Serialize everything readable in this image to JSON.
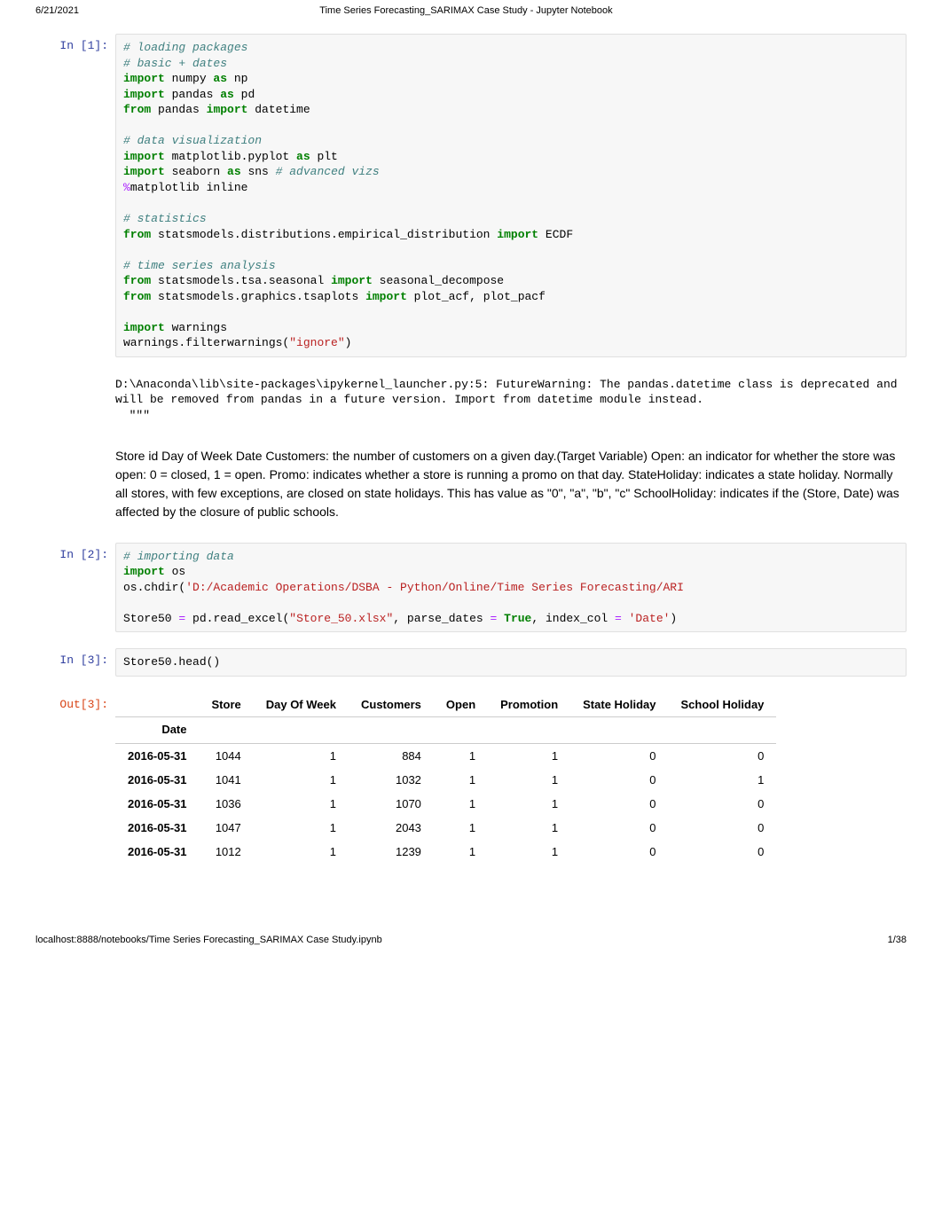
{
  "header": {
    "date": "6/21/2021",
    "title": "Time Series Forecasting_SARIMAX Case Study - Jupyter Notebook"
  },
  "cells": {
    "in1_prompt": "In [1]:",
    "in1": {
      "c1": "# loading packages",
      "c2": "# basic + dates",
      "l3_k1": "import",
      "l3_t1": " numpy ",
      "l3_k2": "as",
      "l3_t2": " np",
      "l4_k1": "import",
      "l4_t1": " pandas ",
      "l4_k2": "as",
      "l4_t2": " pd",
      "l5_k1": "from",
      "l5_t1": " pandas ",
      "l5_k2": "import",
      "l5_t2": " datetime",
      "c6": "# data visualization",
      "l7_k1": "import",
      "l7_t1": " matplotlib.pyplot ",
      "l7_k2": "as",
      "l7_t2": " plt",
      "l8_k1": "import",
      "l8_t1": " seaborn ",
      "l8_k2": "as",
      "l8_t2": " sns ",
      "l8_c": "# advanced vizs",
      "l9_m": "%",
      "l9_t": "matplotlib inline",
      "c10": "# statistics",
      "l11_k1": "from",
      "l11_t1": " statsmodels.distributions.empirical_distribution ",
      "l11_k2": "import",
      "l11_t2": " ECDF",
      "c12": "# time series analysis",
      "l13_k1": "from",
      "l13_t1": " statsmodels.tsa.seasonal ",
      "l13_k2": "import",
      "l13_t2": " seasonal_decompose",
      "l14_k1": "from",
      "l14_t1": " statsmodels.graphics.tsaplots ",
      "l14_k2": "import",
      "l14_t2": " plot_acf, plot_pacf",
      "l15_k1": "import",
      "l15_t1": " warnings",
      "l16_t1": "warnings.filterwarnings(",
      "l16_s": "\"ignore\"",
      "l16_t2": ")"
    },
    "in1_stream": "D:\\Anaconda\\lib\\site-packages\\ipykernel_launcher.py:5: FutureWarning: The pandas.datetime class is deprecated and will be removed from pandas in a future version. Import from datetime module instead.\n  \"\"\"",
    "markdown1": "Store id Day of Week Date Customers: the number of customers on a given day.(Target Variable) Open: an indicator for whether the store was open: 0 = closed, 1 = open. Promo: indicates whether a store is running a promo on that day. StateHoliday: indicates a state holiday. Normally all stores, with few exceptions, are closed on state holidays. This has value as \"0\", \"a\", \"b\", \"c\" SchoolHoliday: indicates if the (Store, Date) was affected by the closure of public schools.",
    "in2_prompt": "In [2]:",
    "in2": {
      "c1": "# importing data",
      "l2_k1": "import",
      "l2_t1": " os",
      "l3_t1": "os.chdir(",
      "l3_s": "'D:/Academic Operations/DSBA - Python/Online/Time Series Forecasting/ARI",
      "l4_t1": "Store50 ",
      "l4_op": "=",
      "l4_t2": " pd.read_excel(",
      "l4_s1": "\"Store_50.xlsx\"",
      "l4_t3": ", parse_dates ",
      "l4_op2": "=",
      "l4_t4": " ",
      "l4_k": "True",
      "l4_t5": ", index_col ",
      "l4_op3": "=",
      "l4_t6": " ",
      "l4_s2": "'Date'",
      "l4_t7": ")"
    },
    "in3_prompt": "In [3]:",
    "in3_code": "Store50.head()",
    "out3_prompt": "Out[3]:",
    "table": {
      "index_name": "Date",
      "columns": [
        "Store",
        "Day Of Week",
        "Customers",
        "Open",
        "Promotion",
        "State Holiday",
        "School Holiday"
      ],
      "rows": [
        {
          "idx": "2016-05-31",
          "vals": [
            "1044",
            "1",
            "884",
            "1",
            "1",
            "0",
            "0"
          ]
        },
        {
          "idx": "2016-05-31",
          "vals": [
            "1041",
            "1",
            "1032",
            "1",
            "1",
            "0",
            "1"
          ]
        },
        {
          "idx": "2016-05-31",
          "vals": [
            "1036",
            "1",
            "1070",
            "1",
            "1",
            "0",
            "0"
          ]
        },
        {
          "idx": "2016-05-31",
          "vals": [
            "1047",
            "1",
            "2043",
            "1",
            "1",
            "0",
            "0"
          ]
        },
        {
          "idx": "2016-05-31",
          "vals": [
            "1012",
            "1",
            "1239",
            "1",
            "1",
            "0",
            "0"
          ]
        }
      ]
    }
  },
  "footer": {
    "url": "localhost:8888/notebooks/Time Series Forecasting_SARIMAX Case Study.ipynb",
    "page": "1/38"
  }
}
